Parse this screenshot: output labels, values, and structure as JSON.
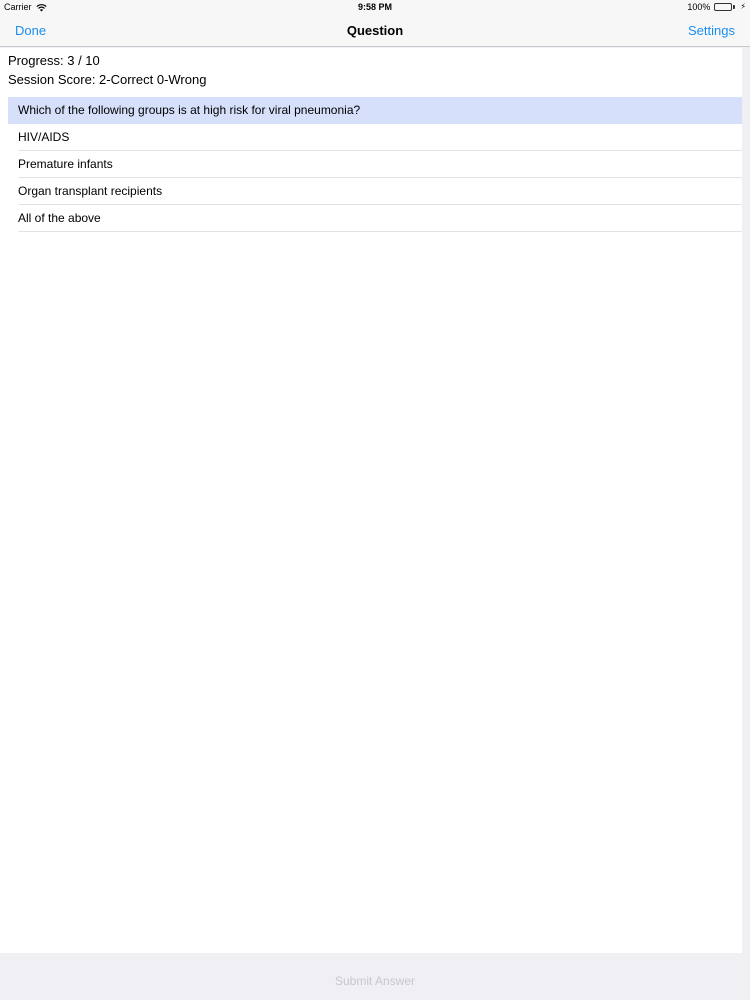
{
  "status_bar": {
    "carrier": "Carrier",
    "time": "9:58 PM",
    "battery": "100%",
    "battery_level": 1.0,
    "battery_color": "#4cd964"
  },
  "nav": {
    "left_label": "Done",
    "title": "Question",
    "right_label": "Settings",
    "accent": "#1a8ef0"
  },
  "session": {
    "progress": "Progress: 3 / 10",
    "score": "Session Score: 2-Correct 0-Wrong"
  },
  "quiz": {
    "question": "Which of the following groups is at high risk for viral pneumonia?",
    "options": [
      "HIV/AIDS",
      "Premature infants",
      "Organ transplant recipients",
      "All of the above"
    ]
  },
  "footer": {
    "submit_label": "Submit Answer"
  },
  "icons": [
    "wifi-icon",
    "battery-icon",
    "charging-icon"
  ]
}
